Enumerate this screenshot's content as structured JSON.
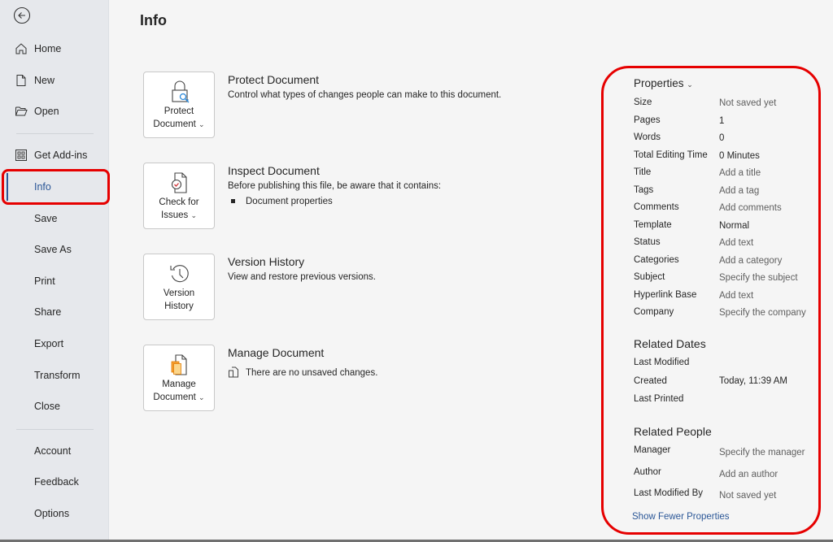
{
  "sidebar": {
    "back_label": "Back",
    "items": [
      {
        "label": "Home",
        "icon": "home-icon"
      },
      {
        "label": "New",
        "icon": "new-document-icon"
      },
      {
        "label": "Open",
        "icon": "folder-open-icon"
      },
      {
        "label": "Get Add-ins",
        "icon": "add-ins-icon"
      },
      {
        "label": "Info",
        "active": true
      },
      {
        "label": "Save"
      },
      {
        "label": "Save As"
      },
      {
        "label": "Print"
      },
      {
        "label": "Share"
      },
      {
        "label": "Export"
      },
      {
        "label": "Transform"
      },
      {
        "label": "Close"
      },
      {
        "label": "Account"
      },
      {
        "label": "Feedback"
      },
      {
        "label": "Options"
      }
    ]
  },
  "page": {
    "title": "Info"
  },
  "sections": [
    {
      "button_line1": "Protect",
      "button_line2": "Document",
      "has_dropdown": true,
      "title": "Protect Document",
      "description": "Control what types of changes people can make to this document."
    },
    {
      "button_line1": "Check for",
      "button_line2": "Issues",
      "has_dropdown": true,
      "title": "Inspect Document",
      "description": "Before publishing this file, be aware that it contains:",
      "bullets": [
        "Document properties"
      ]
    },
    {
      "button_line1": "Version",
      "button_line2": "History",
      "has_dropdown": false,
      "title": "Version History",
      "description": "View and restore previous versions."
    },
    {
      "button_line1": "Manage",
      "button_line2": "Document",
      "has_dropdown": true,
      "title": "Manage Document",
      "description": "There are no unsaved changes."
    }
  ],
  "properties": {
    "header": "Properties",
    "rows": [
      {
        "key": "Size",
        "value": "Not saved yet"
      },
      {
        "key": "Pages",
        "value": "1"
      },
      {
        "key": "Words",
        "value": "0"
      },
      {
        "key": "Total Editing Time",
        "value": "0 Minutes"
      },
      {
        "key": "Title",
        "value": "Add a title"
      },
      {
        "key": "Tags",
        "value": "Add a tag"
      },
      {
        "key": "Comments",
        "value": "Add comments"
      },
      {
        "key": "Template",
        "value": "Normal"
      },
      {
        "key": "Status",
        "value": "Add text"
      },
      {
        "key": "Categories",
        "value": "Add a category"
      },
      {
        "key": "Subject",
        "value": "Specify the subject"
      },
      {
        "key": "Hyperlink Base",
        "value": "Add text"
      },
      {
        "key": "Company",
        "value": "Specify the company"
      }
    ],
    "related_dates": {
      "header": "Related Dates",
      "rows": [
        {
          "key": "Last Modified",
          "value": ""
        },
        {
          "key": "Created",
          "value": "Today, 11:39 AM"
        },
        {
          "key": "Last Printed",
          "value": ""
        }
      ]
    },
    "related_people": {
      "header": "Related People",
      "rows": [
        {
          "key": "Manager",
          "value": "Specify the manager"
        },
        {
          "key": "Author",
          "value": "Add an author"
        },
        {
          "key": "Last Modified By",
          "value": "Not saved yet"
        }
      ]
    },
    "show_fewer_label": "Show Fewer Properties"
  },
  "colors": {
    "accent": "#2b5797",
    "highlight": "#e60000",
    "sidebar_bg": "#e6e8ec",
    "main_bg": "#f5f5f5"
  }
}
